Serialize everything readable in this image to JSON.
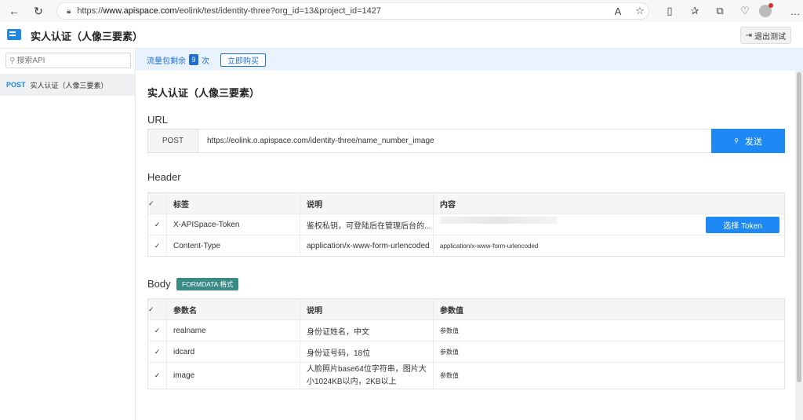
{
  "browser": {
    "url_prefix": "https://",
    "url_domain": "www.apispace.com",
    "url_path": "/eolink/test/identity-three?org_id=13&project_id=1427"
  },
  "header": {
    "title": "实人认证（人像三要素）",
    "exit_label": "退出测试"
  },
  "sidebar": {
    "search_placeholder": "搜索API",
    "items": [
      {
        "method": "POST",
        "label": "实人认证（人像三要素）"
      }
    ]
  },
  "quota": {
    "prefix": "流量包剩余",
    "count": "9",
    "suffix": "次",
    "buy_label": "立即购买"
  },
  "main": {
    "api_title": "实人认证（人像三要素）",
    "url_section": "URL",
    "method": "POST",
    "endpoint": "https://eolink.o.apispace.com/identity-three/name_number_image",
    "send_label": "发送",
    "header_section": "Header",
    "header_table": {
      "columns": [
        "标签",
        "说明",
        "内容"
      ],
      "rows": [
        {
          "name": "X-APISpace-Token",
          "desc": "鉴权私钥，可登陆后在管理后台的...",
          "value": "",
          "action": "选择 Token"
        },
        {
          "name": "Content-Type",
          "desc": "application/x-www-form-urlencoded",
          "value": "application/x-www-form-urlencoded"
        }
      ]
    },
    "body_section": "Body",
    "body_badge": "FORMDATA 格式",
    "body_table": {
      "columns": [
        "参数名",
        "说明",
        "参数值"
      ],
      "rows": [
        {
          "name": "realname",
          "desc": "身份证姓名，中文",
          "placeholder": "参数值"
        },
        {
          "name": "idcard",
          "desc": "身份证号码，18位",
          "placeholder": "参数值"
        },
        {
          "name": "image",
          "desc_line1": "人脸照片base64位字符串，图片大",
          "desc_line2": "小1024KB以内，2KB以上",
          "placeholder": "参数值"
        }
      ]
    }
  }
}
